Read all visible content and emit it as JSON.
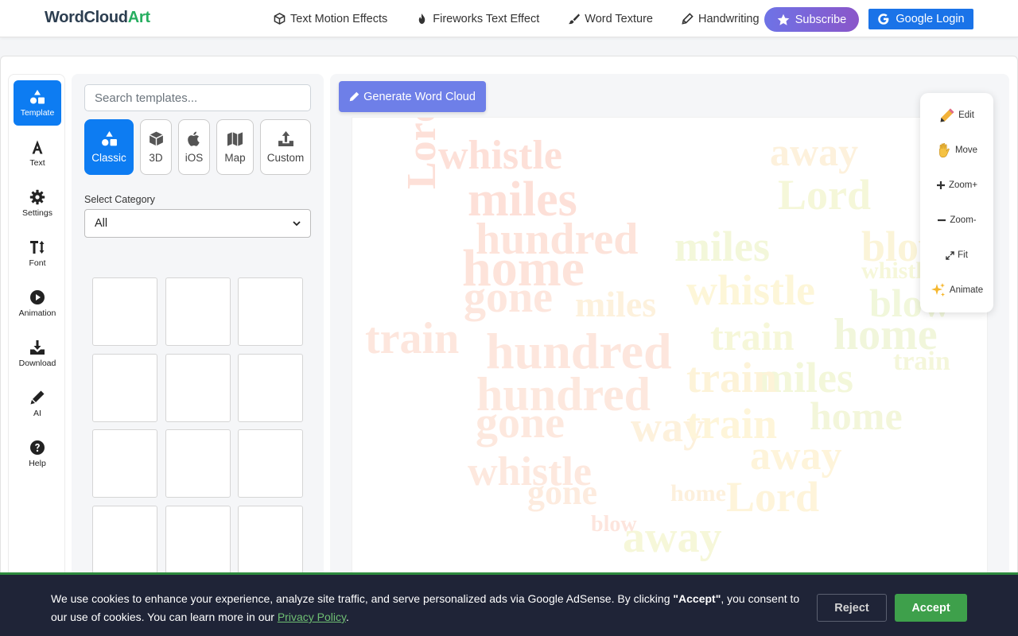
{
  "brand": {
    "part1": "WordCloud",
    "part2": "Art"
  },
  "nav": {
    "links": [
      {
        "label": "Text Motion Effects",
        "icon": "cube-icon"
      },
      {
        "label": "Fireworks Text Effect",
        "icon": "fire-icon"
      },
      {
        "label": "Word Texture",
        "icon": "brush-icon"
      },
      {
        "label": "Handwriting",
        "icon": "pen-icon"
      }
    ],
    "subscribe": "Subscribe",
    "google_login": "Google Login"
  },
  "sidebar": {
    "items": [
      {
        "label": "Template",
        "icon": "shapes-icon",
        "active": true
      },
      {
        "label": "Text",
        "icon": "text-icon"
      },
      {
        "label": "Settings",
        "icon": "gear-icon"
      },
      {
        "label": "Font",
        "icon": "font-size-icon"
      },
      {
        "label": "Animation",
        "icon": "play-circle-icon"
      },
      {
        "label": "Download",
        "icon": "download-icon"
      },
      {
        "label": "AI",
        "icon": "pen-icon"
      },
      {
        "label": "Help",
        "icon": "question-circle-icon"
      }
    ]
  },
  "templates": {
    "search_placeholder": "Search templates...",
    "types": [
      {
        "label": "Classic",
        "icon": "shapes-icon",
        "active": true
      },
      {
        "label": "3D",
        "icon": "cube-icon"
      },
      {
        "label": "iOS",
        "icon": "apple-icon"
      },
      {
        "label": "Map",
        "icon": "map-icon"
      },
      {
        "label": "Custom",
        "icon": "upload-icon"
      }
    ],
    "category_label": "Select Category",
    "category_value": "All"
  },
  "canvas": {
    "generate_label": "Generate Word Cloud",
    "tools": [
      {
        "label": "Edit",
        "icon": "pencil-icon"
      },
      {
        "label": "Move",
        "icon": "hand-icon"
      },
      {
        "label": "Zoom+",
        "icon": "plus-icon"
      },
      {
        "label": "Zoom-",
        "icon": "minus-icon"
      },
      {
        "label": "Fit",
        "icon": "expand-icon"
      },
      {
        "label": "Animate",
        "icon": "sparkles-icon"
      }
    ],
    "words": [
      {
        "text": "whistle",
        "color": "#fde0d8"
      },
      {
        "text": "miles",
        "color": "#fde0d8"
      },
      {
        "text": "Lord",
        "color": "#fde0d8"
      },
      {
        "text": "hundred",
        "color": "#fde3da"
      },
      {
        "text": "home",
        "color": "#fde3da"
      },
      {
        "text": "gone",
        "color": "#fde6dd"
      },
      {
        "text": "train",
        "color": "#fde6dd"
      },
      {
        "text": "hundred",
        "color": "#fde6dd"
      },
      {
        "text": "hundred",
        "color": "#fde8de"
      },
      {
        "text": "gone",
        "color": "#fde8de"
      },
      {
        "text": "whistle",
        "color": "#fde8de"
      },
      {
        "text": "gone",
        "color": "#fdebde"
      },
      {
        "text": "away",
        "color": "#fdf1dc"
      },
      {
        "text": "way",
        "color": "#fdf1dc"
      },
      {
        "text": "away",
        "color": "#fef4da"
      },
      {
        "text": "Lord",
        "color": "#fef4da"
      },
      {
        "text": "train",
        "color": "#fef5d9"
      },
      {
        "text": "whistle",
        "color": "#fdf6d8"
      },
      {
        "text": "miles",
        "color": "#fdf1dc"
      },
      {
        "text": "blow",
        "color": "#fbf4d8"
      },
      {
        "text": "away",
        "color": "#f6f7d9"
      },
      {
        "text": "Lord",
        "color": "#f5f7d9"
      },
      {
        "text": "miles",
        "color": "#f3f7da"
      },
      {
        "text": "blow",
        "color": "#f1f7db"
      },
      {
        "text": "whistle",
        "color": "#f6f7d9"
      },
      {
        "text": "blow",
        "color": "#eff6dc"
      },
      {
        "text": "train",
        "color": "#f6f7d9"
      },
      {
        "text": "home",
        "color": "#f1f6db"
      },
      {
        "text": "miles",
        "color": "#f3f7da"
      },
      {
        "text": "train",
        "color": "#fdf3d8"
      },
      {
        "text": "home",
        "color": "#f3f6da"
      },
      {
        "text": "train",
        "color": "#f4f6da"
      },
      {
        "text": "home",
        "color": "#fdf0dc"
      },
      {
        "text": "blow",
        "color": "#fde5dd"
      }
    ]
  },
  "cookie": {
    "text_before": "We use cookies to enhance your experience, analyze site traffic, and serve personalized ads via Google AdSense. By clicking ",
    "accept_quote": "\"Accept\"",
    "text_after": ", you consent to our use of cookies. You can learn more in our ",
    "policy_link": "Privacy Policy",
    "end": ".",
    "reject": "Reject",
    "accept": "Accept"
  }
}
